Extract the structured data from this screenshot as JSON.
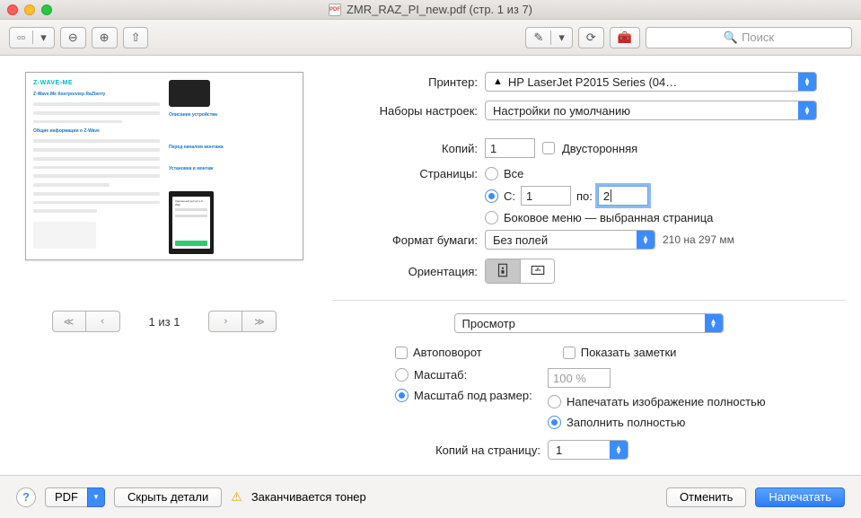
{
  "title": "ZMR_RAZ_PI_new.pdf (стр. 1 из 7)",
  "toolbar": {
    "search_placeholder": "Поиск"
  },
  "thumb": {
    "logo": "Z-WAVE›ME",
    "subtitle": "Z-Wave.Me Контроллер RaZberry",
    "screenTitle": "Удаленный доступ к Z-Way"
  },
  "nav": {
    "page_indicator": "1 из 1"
  },
  "labels": {
    "printer": "Принтер:",
    "presets": "Наборы настроек:",
    "copies": "Копий:",
    "duplex": "Двусторонняя",
    "pages": "Страницы:",
    "all": "Все",
    "from": "С:",
    "to": "по:",
    "sidemenu": "Боковое меню — выбранная страница",
    "paper": "Формат бумаги:",
    "paper_hint": "210 на 297 мм",
    "orientation": "Ориентация:",
    "autorotate": "Автоповорот",
    "shownotes": "Показать заметки",
    "scale": "Масштаб:",
    "scale_fit": "Масштаб под размер:",
    "print_entire": "Напечатать изображение полностью",
    "fill_entire": "Заполнить полностью",
    "copies_per_page": "Копий на страницу:"
  },
  "values": {
    "printer": "HP LaserJet P2015 Series (04…",
    "preset": "Настройки по умолчанию",
    "copies": "1",
    "from": "1",
    "to": "2",
    "paper": "Без полей",
    "module": "Просмотр",
    "scale_value": "100 %",
    "cpp": "1"
  },
  "footer": {
    "pdf": "PDF",
    "hide": "Скрыть детали",
    "toner": "Заканчивается тонер",
    "cancel": "Отменить",
    "print": "Напечатать"
  }
}
